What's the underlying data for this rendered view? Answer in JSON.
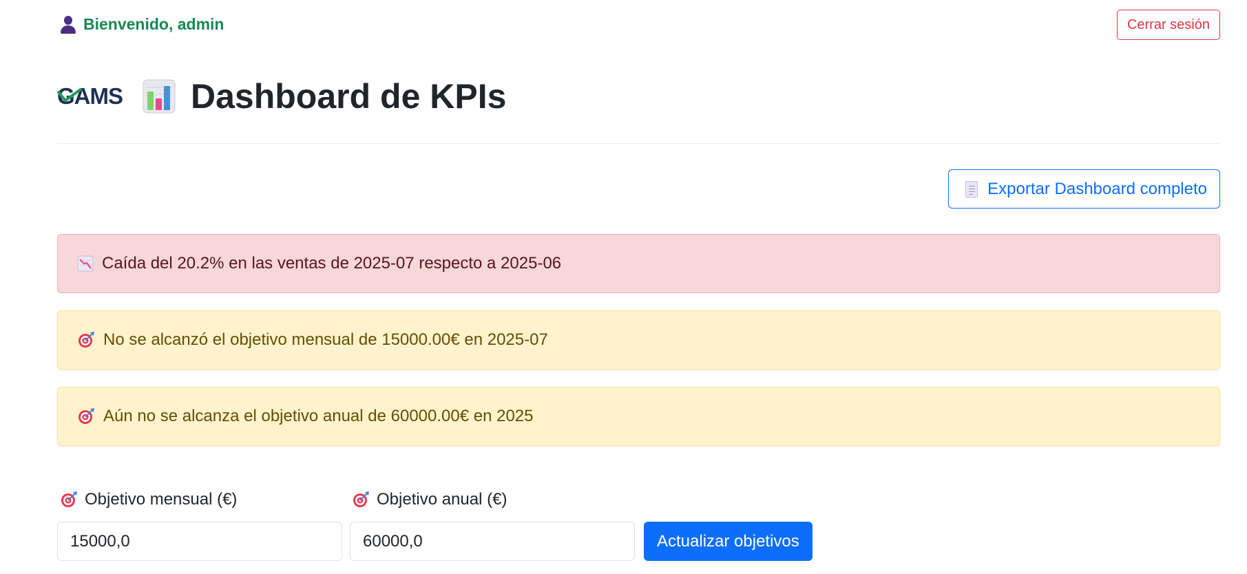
{
  "topbar": {
    "welcome_text": "Bienvenido, admin",
    "welcome_icon": "user-icon",
    "logout_label": "Cerrar sesión"
  },
  "header": {
    "logo_text": "GAMS",
    "title_icon": "bar-chart-icon",
    "title": "Dashboard de KPIs"
  },
  "actions": {
    "export_icon": "document-icon",
    "export_label": "Exportar Dashboard completo"
  },
  "alerts": [
    {
      "type": "danger",
      "icon": "chart-decreasing-icon",
      "text": "Caída del 20.2% en las ventas de 2025-07 respecto a 2025-06"
    },
    {
      "type": "warning",
      "icon": "target-icon",
      "text": "No se alcanzó el objetivo mensual de 15000.00€ en 2025-07"
    },
    {
      "type": "warning",
      "icon": "target-icon",
      "text": "Aún no se alcanza el objetivo anual de 60000.00€ en 2025"
    }
  ],
  "form": {
    "monthly_label": "Objetivo mensual (€)",
    "monthly_value": "15000,0",
    "annual_label": "Objetivo anual (€)",
    "annual_value": "60000,0",
    "submit_label": "Actualizar objetivos"
  },
  "colors": {
    "success": "#198754",
    "danger": "#dc3545",
    "primary": "#0d6efd",
    "danger_bg": "#f8d7da",
    "warning_bg": "#fff3cd"
  }
}
